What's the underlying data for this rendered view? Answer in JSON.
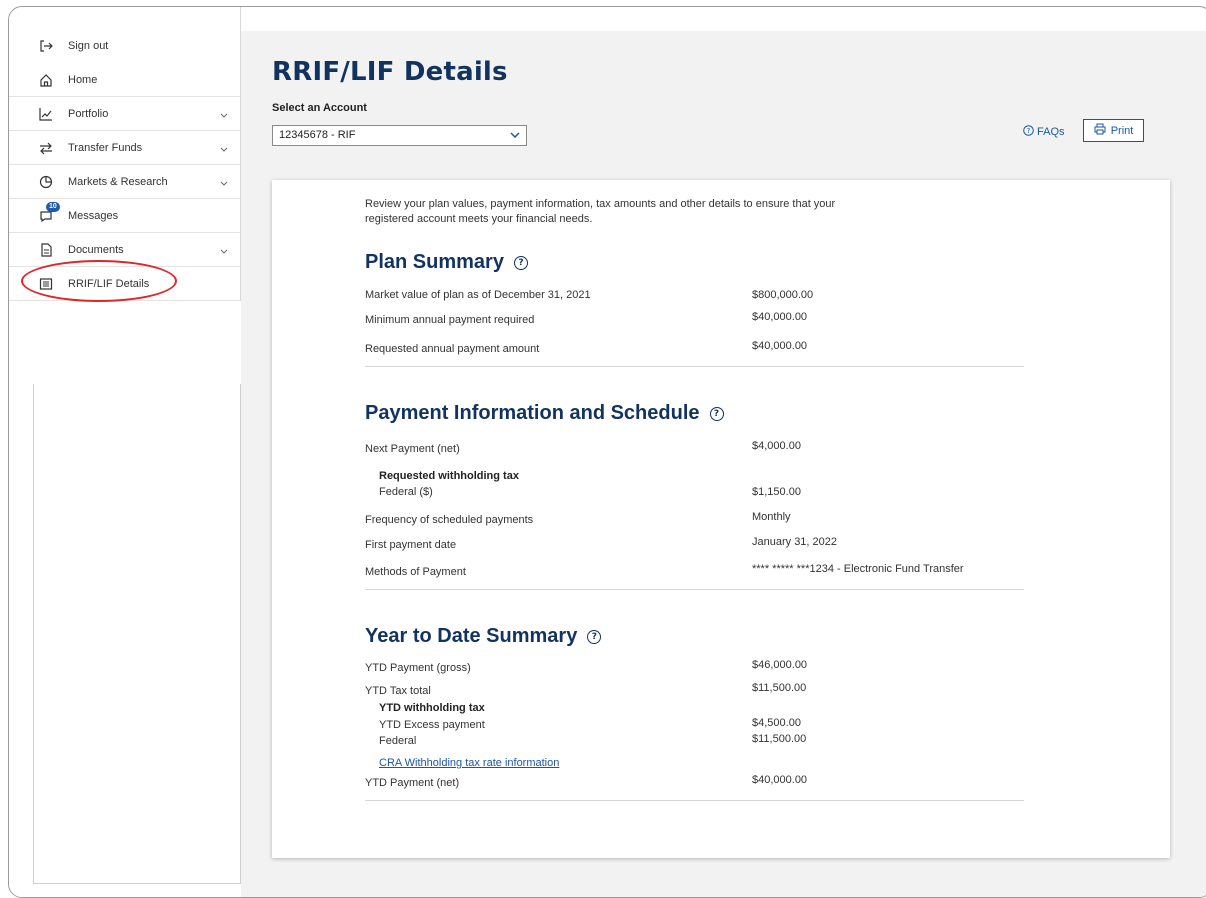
{
  "sidebar": {
    "items": [
      {
        "label": "Sign out",
        "icon": "sign-out-icon"
      },
      {
        "label": "Home",
        "icon": "home-icon"
      },
      {
        "label": "Portfolio",
        "icon": "chart-line-icon",
        "expandable": true
      },
      {
        "label": "Transfer Funds",
        "icon": "transfer-arrows-icon",
        "expandable": true
      },
      {
        "label": "Markets & Research",
        "icon": "pie-chart-icon",
        "expandable": true
      },
      {
        "label": "Messages",
        "icon": "chat-bubble-icon",
        "badge": "10"
      },
      {
        "label": "Documents",
        "icon": "document-icon",
        "expandable": true
      },
      {
        "label": "RRIF/LIF Details",
        "icon": "list-icon",
        "highlighted": true
      }
    ]
  },
  "header": {
    "title": "RRIF/LIF Details",
    "account_label": "Select an Account",
    "account_value": "12345678 - RIF",
    "faqs_label": "FAQs",
    "print_label": "Print"
  },
  "intro": "Review your plan values, payment information, tax amounts and other details to ensure that your registered account meets your financial needs.",
  "plan_summary": {
    "title": "Plan Summary",
    "rows": [
      {
        "label": "Market value of plan as of December 31, 2021",
        "value": "$800,000.00"
      },
      {
        "label": "Minimum annual payment required",
        "value": "$40,000.00"
      },
      {
        "label": "Requested annual payment amount",
        "value": "$40,000.00"
      }
    ]
  },
  "payment_info": {
    "title": "Payment Information and Schedule",
    "next_payment_label": "Next Payment (net)",
    "next_payment_value": "$4,000.00",
    "withholding_heading": "Requested withholding tax",
    "federal_label": "Federal ($)",
    "federal_value": "$1,150.00",
    "frequency_label": "Frequency of scheduled payments",
    "frequency_value": "Monthly",
    "first_payment_label": "First payment date",
    "first_payment_value": "January 31, 2022",
    "methods_label": "Methods of Payment",
    "methods_value": "**** ***** ***1234 - Electronic Fund Transfer"
  },
  "ytd": {
    "title": "Year to Date Summary",
    "gross_label": "YTD Payment (gross)",
    "gross_value": "$46,000.00",
    "tax_total_label": "YTD Tax total",
    "tax_total_value": "$11,500.00",
    "withholding_heading": "YTD withholding tax",
    "excess_label": "YTD Excess payment",
    "excess_value": "$4,500.00",
    "federal_label": "Federal",
    "federal_value": "$11,500.00",
    "cra_link": "CRA Withholding tax rate information",
    "net_label": "YTD Payment (net)",
    "net_value": "$40,000.00"
  },
  "colors": {
    "brand_navy": "#12335f",
    "link_blue": "#1a56a8",
    "annotation_red": "#e0252a",
    "badge_blue": "#1f5ba8"
  }
}
